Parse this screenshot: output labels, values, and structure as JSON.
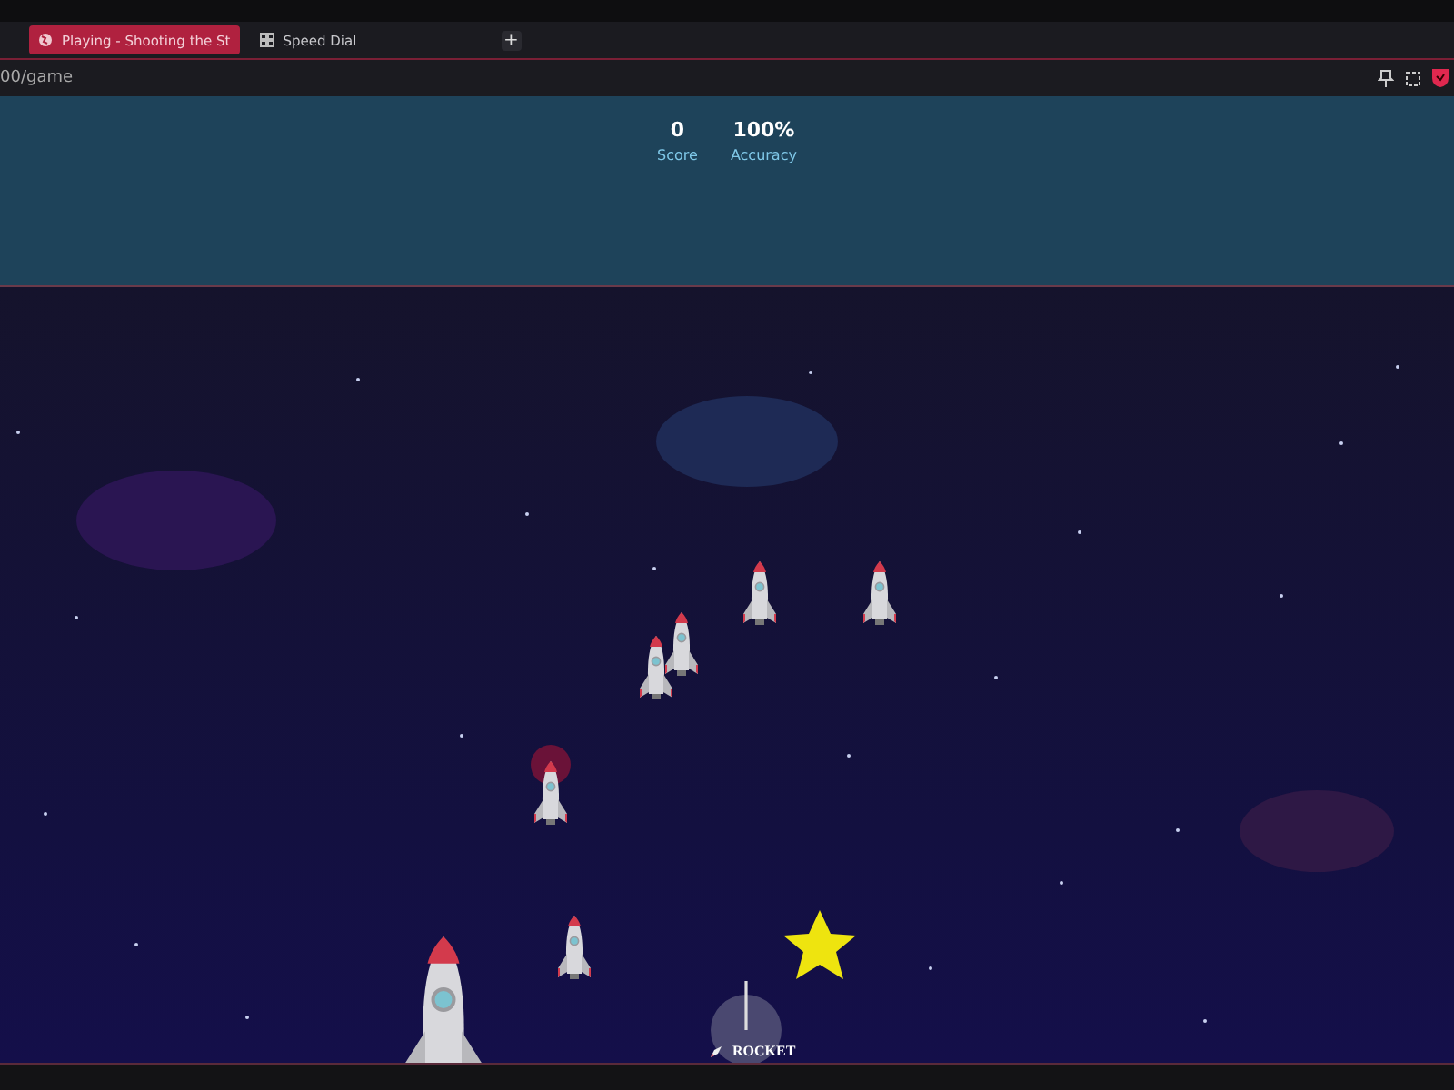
{
  "tabs": [
    {
      "label": "Playing - Shooting the St",
      "selected": true,
      "kind": "page"
    },
    {
      "label": "Speed Dial",
      "selected": false,
      "kind": "dial"
    }
  ],
  "new_tab": "+",
  "address": "00/game",
  "hud": [
    {
      "value": "0",
      "label": "Score"
    },
    {
      "value": "100%",
      "label": "Accuracy"
    }
  ],
  "weapon": {
    "label": "ROCKET"
  }
}
